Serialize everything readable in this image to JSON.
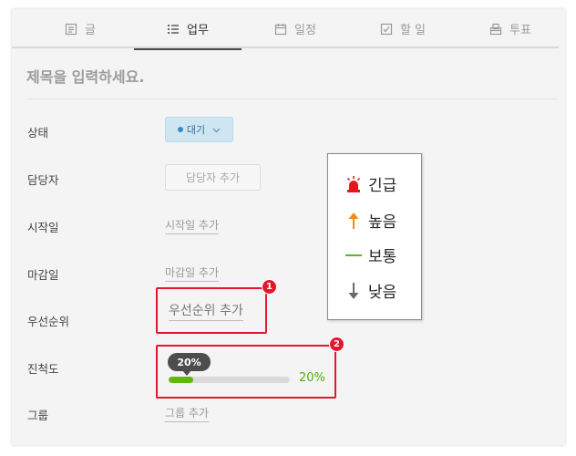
{
  "tabs": [
    {
      "label": "글",
      "icon": "document-icon",
      "active": false
    },
    {
      "label": "업무",
      "icon": "list-icon",
      "active": true
    },
    {
      "label": "일정",
      "icon": "calendar-icon",
      "active": false
    },
    {
      "label": "할 일",
      "icon": "checkbox-icon",
      "active": false
    },
    {
      "label": "투표",
      "icon": "ballot-box-icon",
      "active": false
    }
  ],
  "title_placeholder": "제목을 입력하세요.",
  "fields": {
    "status_label": "상태",
    "status_value": "대기",
    "assignee_label": "담당자",
    "assignee_add": "담당자 추가",
    "start_label": "시작일",
    "start_add": "시작일 추가",
    "due_label": "마감일",
    "due_add": "마감일 추가",
    "priority_label": "우선순위",
    "priority_add": "우선순위 추가",
    "progress_label": "진척도",
    "progress_tip": "20%",
    "progress_value": "20%",
    "progress_fraction": 0.2,
    "group_label": "그룹",
    "group_add": "그룹 추가"
  },
  "callouts": {
    "one": "1",
    "two": "2"
  },
  "priority_legend": [
    {
      "label": "긴급",
      "icon": "siren-icon",
      "color": "#e8161c"
    },
    {
      "label": "높음",
      "icon": "arrow-up-icon",
      "color": "#f08a1c"
    },
    {
      "label": "보통",
      "icon": "dash-icon",
      "color": "#5cb81a"
    },
    {
      "label": "낮음",
      "icon": "arrow-down-icon",
      "color": "#6b6b6b"
    }
  ],
  "colors": {
    "accent_red": "#e3172c",
    "status_bg": "#cfe6f2",
    "status_text": "#2f6f98",
    "progress_green": "#5fb80b"
  }
}
